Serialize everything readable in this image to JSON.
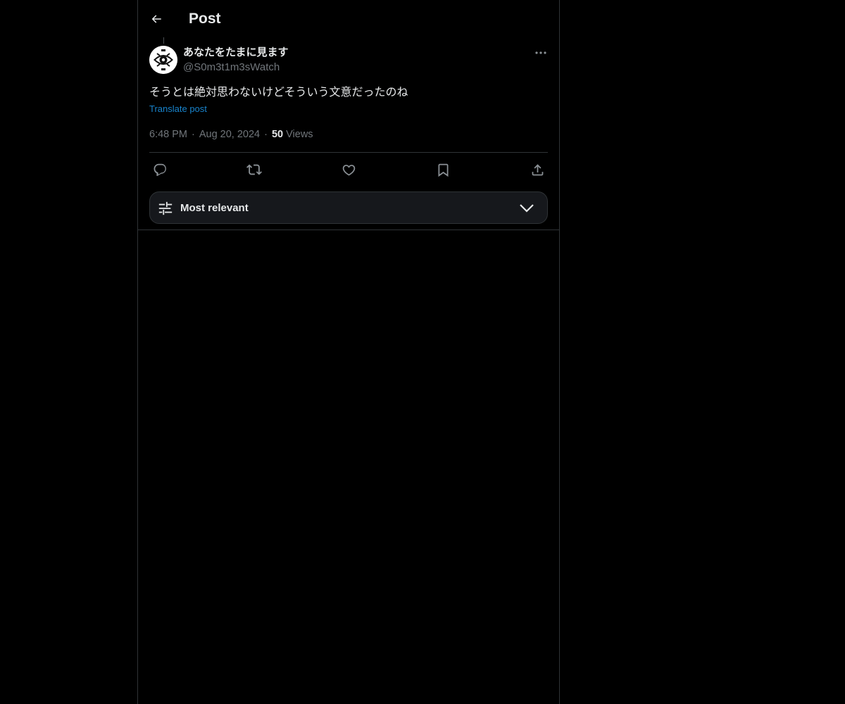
{
  "header": {
    "title": "Post",
    "back_icon": "arrow-left-icon"
  },
  "post": {
    "author": {
      "display_name": "あなたをたまに見ます",
      "handle": "@S0m3t1m3sWatch",
      "avatar_icon": "eye-emblem-avatar"
    },
    "text": "そうとは絶対思わないけどそういう文意だったのね",
    "translate_label": "Translate post",
    "time": "6:48 PM",
    "separator": "·",
    "date": "Aug 20, 2024",
    "views_count": "50",
    "views_label": "Views",
    "more_icon": "more-horizontal-icon"
  },
  "actions": [
    {
      "name": "reply",
      "icon": "reply-icon"
    },
    {
      "name": "repost",
      "icon": "repost-icon"
    },
    {
      "name": "like",
      "icon": "heart-icon"
    },
    {
      "name": "bookmark",
      "icon": "bookmark-icon"
    },
    {
      "name": "share",
      "icon": "share-icon"
    }
  ],
  "sort": {
    "label": "Most relevant",
    "icon": "sliders-icon",
    "chevron": "chevron-down-icon"
  },
  "colors": {
    "background": "#000000",
    "text_primary": "#e7e9ea",
    "text_secondary": "#71767b",
    "link": "#1d9bf0",
    "border": "#2f3336"
  }
}
